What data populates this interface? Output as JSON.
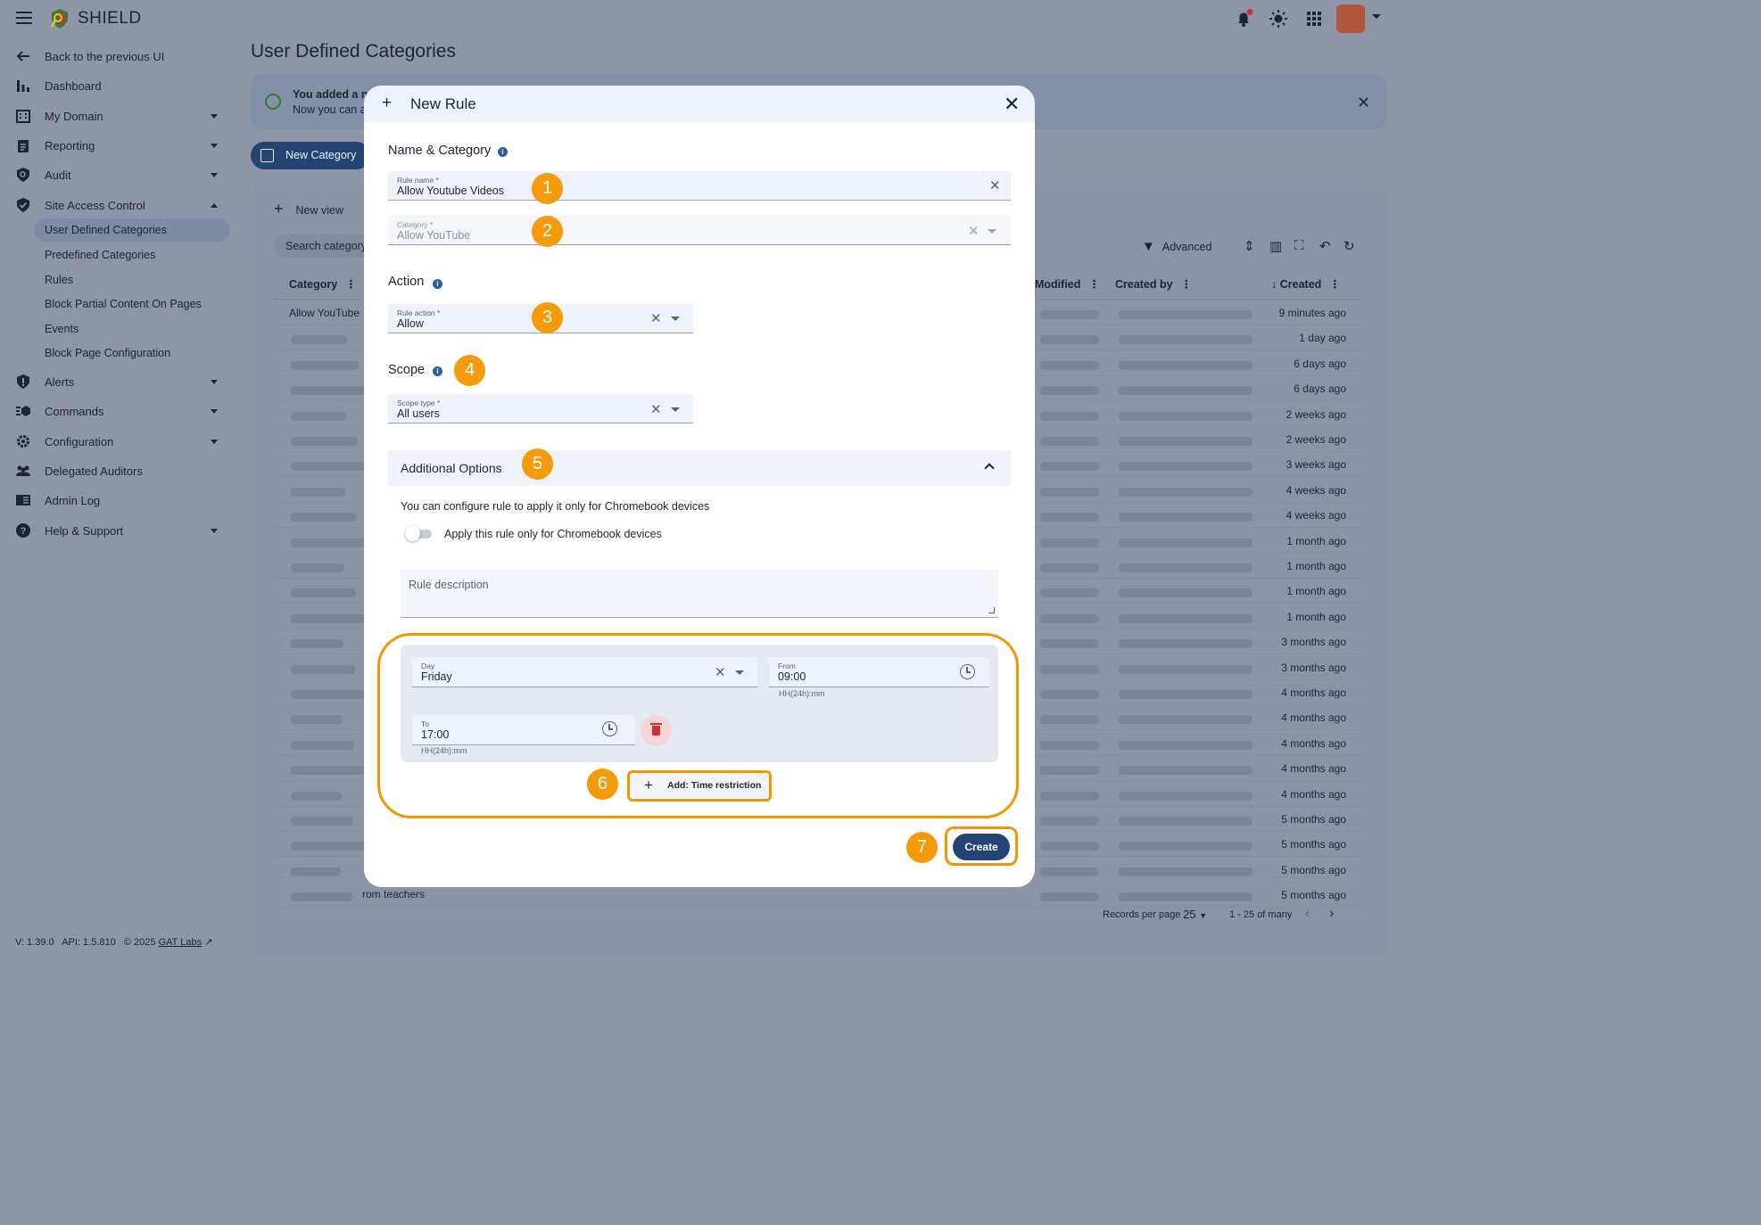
{
  "app": {
    "brand": "SHIELD",
    "version": "V: 1.39.0",
    "api": "API: 1.5.810",
    "copyright": "© 2025",
    "company_link": "GAT Labs"
  },
  "sidebar": {
    "back": "Back to the previous UI",
    "items": [
      {
        "label": "Dashboard"
      },
      {
        "label": "My Domain"
      },
      {
        "label": "Reporting"
      },
      {
        "label": "Audit"
      },
      {
        "label": "Site Access Control"
      },
      {
        "label": "Alerts"
      },
      {
        "label": "Commands"
      },
      {
        "label": "Configuration"
      },
      {
        "label": "Delegated Auditors"
      },
      {
        "label": "Admin Log"
      },
      {
        "label": "Help & Support"
      }
    ],
    "sub_items": [
      {
        "label": "User Defined Categories"
      },
      {
        "label": "Predefined Categories"
      },
      {
        "label": "Rules"
      },
      {
        "label": "Block Partial Content On Pages"
      },
      {
        "label": "Events"
      },
      {
        "label": "Block Page Configuration"
      }
    ]
  },
  "page": {
    "title": "User Defined Categories",
    "alert_line1": "You added a ne",
    "alert_line2": "Now you can a",
    "new_category": "New Category",
    "new_view": "New view",
    "search_placeholder": "Search category",
    "advanced": "Advanced",
    "table": {
      "headers": {
        "category": "Category",
        "modified": "Modified",
        "created_by": "Created by",
        "created": "Created"
      },
      "first_category": "Allow YouTube",
      "created": [
        "9 minutes ago",
        "1 day ago",
        "6 days ago",
        "6 days ago",
        "2 weeks ago",
        "2 weeks ago",
        "3 weeks ago",
        "4 weeks ago",
        "4 weeks ago",
        "1 month ago",
        "1 month ago",
        "1 month ago",
        "1 month ago",
        "3 months ago",
        "3 months ago",
        "4 months ago",
        "4 months ago",
        "4 months ago",
        "4 months ago",
        "4 months ago",
        "5 months ago",
        "5 months ago",
        "5 months ago",
        "5 months ago"
      ],
      "bottom_row_text": "rom teachers"
    },
    "pager": {
      "label": "Records per page",
      "value": "25",
      "range": "1 - 25 of many"
    }
  },
  "modal": {
    "title": "New Rule",
    "section_name": "Name & Category",
    "rule_name": {
      "label": "Rule name *",
      "value": "Allow Youtube Videos"
    },
    "category": {
      "label": "Category *",
      "value": "Allow YouTube"
    },
    "section_action": "Action",
    "rule_action": {
      "label": "Rule action *",
      "value": "Allow"
    },
    "section_scope": "Scope",
    "scope_type": {
      "label": "Scope type *",
      "value": "All users"
    },
    "additional_options": "Additional Options",
    "chromebook_text": "You can configure rule to apply it only for Chromebook devices",
    "chromebook_toggle": "Apply this rule only for Chromebook devices",
    "description_placeholder": "Rule description",
    "time_restriction": {
      "day": {
        "label": "Day",
        "value": "Friday"
      },
      "from": {
        "label": "From",
        "value": "09:00",
        "hint": "HH(24h):mm"
      },
      "to": {
        "label": "To",
        "value": "17:00",
        "hint": "HH(24h):mm"
      }
    },
    "add_button": "Add: Time restriction",
    "create_button": "Create"
  },
  "badges": [
    "1",
    "2",
    "3",
    "4",
    "5",
    "6",
    "7"
  ],
  "colors": {
    "accent": "#244573",
    "highlight": "#f59500",
    "danger": "#d32f2f"
  }
}
